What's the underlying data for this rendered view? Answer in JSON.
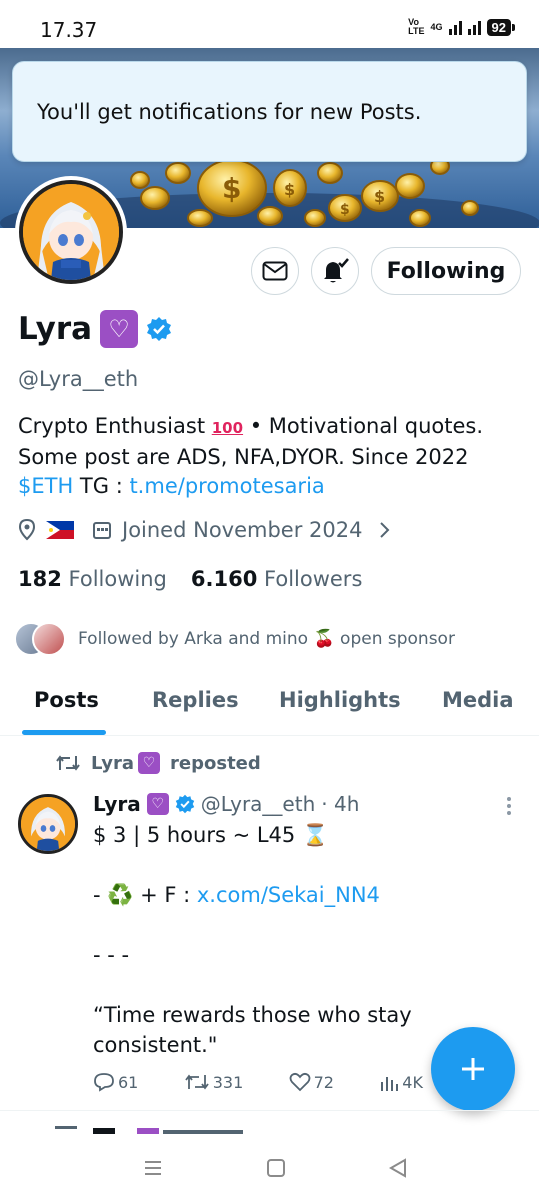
{
  "status_bar": {
    "time": "17.37",
    "volte_top": "Vo",
    "volte_bottom": "LTE",
    "network": "4G",
    "battery": "92"
  },
  "toast": {
    "message": "You'll get notifications for new Posts."
  },
  "profile": {
    "name": "Lyra",
    "handle": "@Lyra__eth",
    "bio_line1": "Crypto Enthusiast",
    "bio_100": "100",
    "bio_line1_rest": " • Motivational quotes.",
    "bio_line2": "Some post are ADS, NFA,DYOR. Since 2022",
    "bio_cashtag": "$ETH",
    "bio_tg_label": " TG : ",
    "bio_tg_link": "t.me/promotesaria",
    "joined": "Joined November 2024",
    "following_count": "182",
    "following_label": "Following",
    "followers_count": "6.160",
    "followers_label": "Followers",
    "followed_by": "Followed by Arka and mino 🍒 open sponsor"
  },
  "actions": {
    "follow_button": "Following",
    "message_icon": "envelope-icon",
    "notify_icon": "bell-check-icon"
  },
  "tabs": [
    {
      "label": "Posts"
    },
    {
      "label": "Replies"
    },
    {
      "label": "Highlights"
    },
    {
      "label": "Media"
    }
  ],
  "post": {
    "repost_name": "Lyra",
    "repost_label": "reposted",
    "author": "Lyra",
    "handle": "@Lyra__eth",
    "time": "· 4h",
    "line1": "$ 3 | 5 hours ~  L45 ⌛",
    "line2_prefix": "- ♻️ + F : ",
    "line2_link": "x.com/Sekai_NN4",
    "line3": "- - -",
    "line4": "“Time rewards those who stay",
    "line5": "consistent.\"",
    "replies": "61",
    "reposts": "331",
    "likes": "72",
    "views": "4K"
  },
  "colors": {
    "accent": "#1d9bf0",
    "text": "#0f1419",
    "muted": "#536471"
  }
}
